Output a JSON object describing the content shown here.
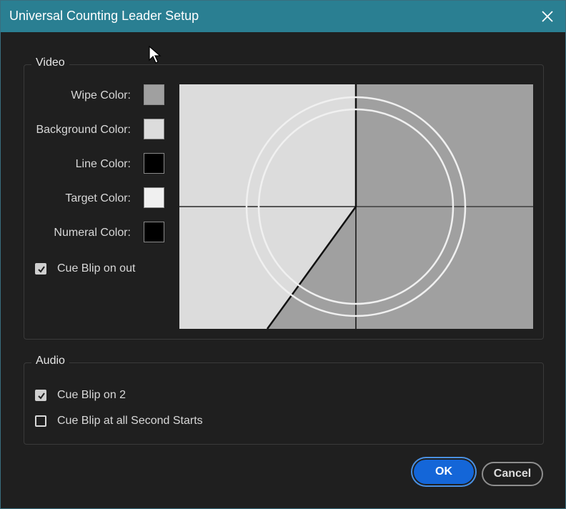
{
  "window": {
    "title": "Universal Counting Leader Setup"
  },
  "video": {
    "legend": "Video",
    "wipe_color_label": "Wipe Color:",
    "background_color_label": "Background Color:",
    "line_color_label": "Line Color:",
    "target_color_label": "Target Color:",
    "numeral_color_label": "Numeral Color:",
    "colors": {
      "wipe": "#a0a0a0",
      "background": "#dcdcdc",
      "line": "#000000",
      "target": "#f0f0f0",
      "numeral": "#000000"
    },
    "cue_blip_on_out": {
      "label": "Cue Blip on out",
      "checked": true
    }
  },
  "audio": {
    "legend": "Audio",
    "cue_blip_on_2": {
      "label": "Cue Blip on 2",
      "checked": true
    },
    "cue_blip_all_seconds": {
      "label": "Cue Blip at all Second Starts",
      "checked": false
    }
  },
  "buttons": {
    "ok": "OK",
    "cancel": "Cancel"
  },
  "icons": {
    "close": "close-icon",
    "check": "checkmark-icon",
    "cursor": "mouse-pointer-icon"
  }
}
